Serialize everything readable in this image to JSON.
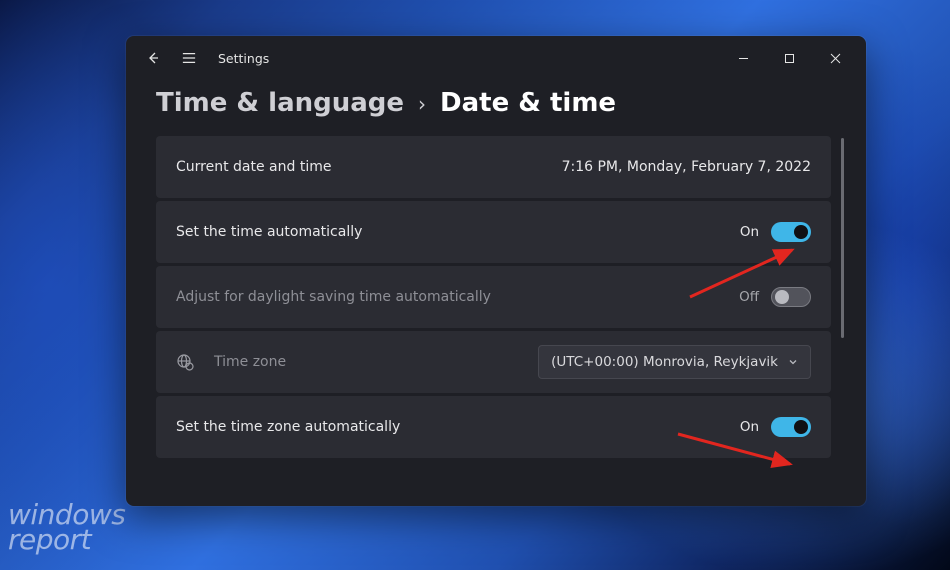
{
  "watermark": {
    "line1": "windows",
    "line2": "report"
  },
  "titlebar": {
    "app_name": "Settings"
  },
  "breadcrumb": {
    "parent": "Time & language",
    "current": "Date & time"
  },
  "rows": {
    "current_label": "Current date and time",
    "current_value": "7:16 PM, Monday, February 7, 2022",
    "auto_time_label": "Set the time automatically",
    "auto_time_state": "On",
    "dst_label": "Adjust for daylight saving time automatically",
    "dst_state": "Off",
    "timezone_label": "Time zone",
    "timezone_value": "(UTC+00:00) Monrovia, Reykjavik",
    "auto_tz_label": "Set the time zone automatically",
    "auto_tz_state": "On"
  }
}
